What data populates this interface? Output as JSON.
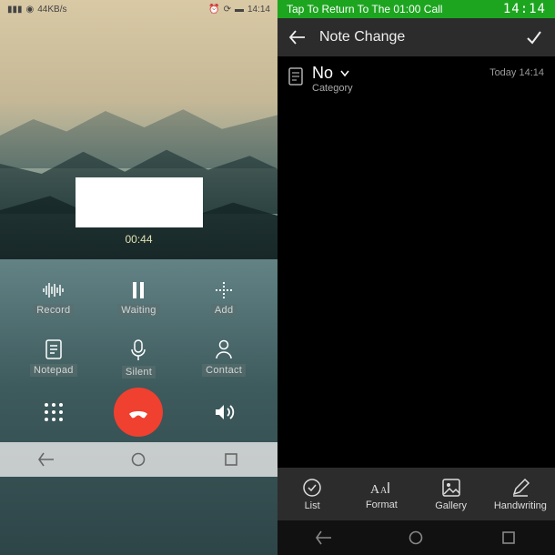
{
  "left": {
    "status": {
      "speed": "44KB/s",
      "time": "14:14"
    },
    "duration": "00:44",
    "buttons": {
      "record": "Record",
      "waiting": "Waiting",
      "add": "Add",
      "notepad": "Notepad",
      "silent": "Silent",
      "contact": "Contact"
    }
  },
  "right": {
    "returnbar": "Tap To Return To The 01:00 Call",
    "clock": "14:14",
    "title": "Note Change",
    "note_title": "No",
    "category": "Category",
    "timestamp": "Today 14:14",
    "toolbar": {
      "list": "List",
      "format": "Format",
      "gallery": "Gallery",
      "handwriting": "Handwriting"
    }
  }
}
